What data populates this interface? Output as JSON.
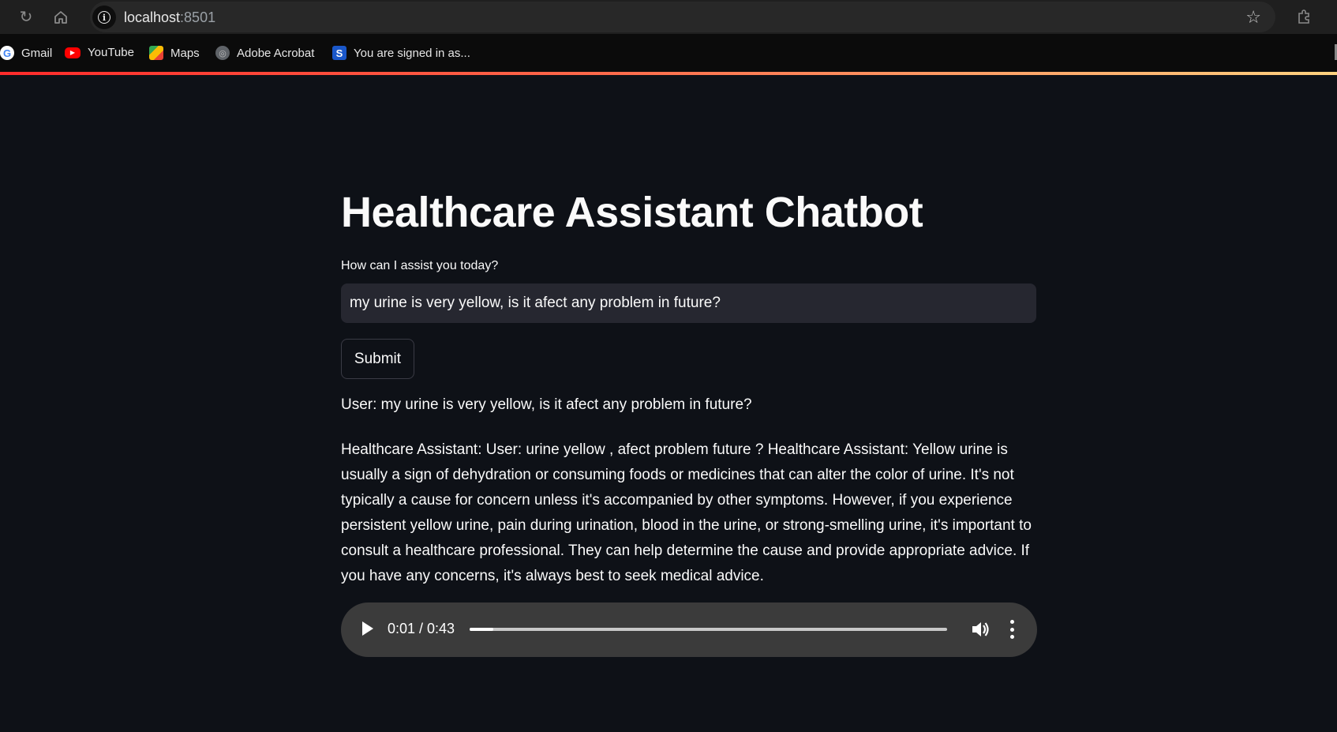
{
  "browser": {
    "url_host": "localhost",
    "url_port": ":8501",
    "bookmarks": [
      {
        "label": "Gmail",
        "icon": "google-icon"
      },
      {
        "label": "YouTube",
        "icon": "youtube-icon"
      },
      {
        "label": "Maps",
        "icon": "maps-icon"
      },
      {
        "label": "Adobe Acrobat",
        "icon": "globe-icon"
      },
      {
        "label": "You are signed in as...",
        "icon": "s-icon"
      }
    ]
  },
  "app": {
    "title": "Healthcare Assistant Chatbot",
    "input_label": "How can I assist you today?",
    "input_value": "my urine is very yellow, is it afect any problem in future?",
    "submit_label": "Submit",
    "user_message": "User: my urine is very yellow, is it afect any problem in future?",
    "assistant_message": "Healthcare Assistant: User: urine yellow , afect problem future ? Healthcare Assistant: Yellow urine is usually a sign of dehydration or consuming foods or medicines that can alter the color of urine. It's not typically a cause for concern unless it's accompanied by other symptoms. However, if you experience persistent yellow urine, pain during urination, blood in the urine, or strong-smelling urine, it's important to consult a healthcare professional. They can help determine the cause and provide appropriate advice. If you have any concerns, it's always best to seek medical advice.",
    "audio": {
      "time_display": "0:01 / 0:43",
      "progress_fraction": 0.05
    }
  },
  "colors": {
    "background": "#0e1117",
    "input_bg": "#262730",
    "audio_bg": "#3b3b3b",
    "accent_start": "#ff2b2b",
    "accent_end": "#ffd280"
  }
}
